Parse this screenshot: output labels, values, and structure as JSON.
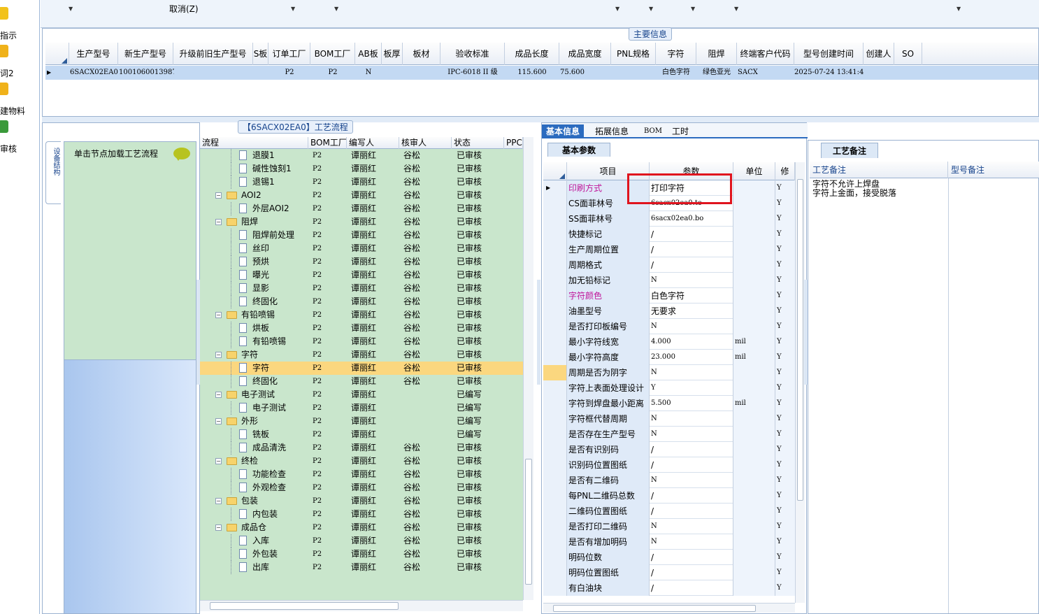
{
  "sidebar": {
    "items": [
      {
        "label": "指示",
        "icon": "lightning-icon"
      },
      {
        "label": "词2",
        "icon": "hand-icon"
      },
      {
        "label": "建物料",
        "icon": "hand-icon"
      },
      {
        "label": "审核",
        "icon": "person-icon"
      }
    ]
  },
  "toolbar": {
    "cancel_label": "取消(Z)"
  },
  "main_info": {
    "title": "主要信息",
    "columns": [
      "生产型号",
      "新生产型号",
      "升级前旧生产型号",
      "S板",
      "订单工厂",
      "BOM工厂",
      "AB板",
      "板厚",
      "板材",
      "验收标准",
      "成品长度",
      "成品宽度",
      "PNL规格",
      "字符",
      "阻焊",
      "终端客户代码",
      "型号创建时间",
      "创建人",
      "SO"
    ],
    "row": [
      "6SACX02EA0",
      "10010600139875",
      "",
      "",
      "P2",
      "P2",
      "N",
      "",
      "",
      "IPC-6018 II 级",
      "115.600",
      "75.600",
      "",
      "白色字符",
      "绿色亚光",
      "SACX",
      "2025-07-24 13:41:41",
      "",
      ""
    ]
  },
  "left_panel": {
    "vertical_tab": "设备结构",
    "load_hint": "单击节点加载工艺流程"
  },
  "process": {
    "title": "【6SACX02EA0】工艺流程",
    "columns": [
      "流程",
      "BOM工厂",
      "编写人",
      "核审人",
      "状态",
      "PPC"
    ],
    "rows": [
      {
        "level": 2,
        "name": "退膜1",
        "bom": "P2",
        "writer": "谭丽红",
        "reviewer": "谷松",
        "status": "已审核"
      },
      {
        "level": 2,
        "name": "碱性蚀刻1",
        "bom": "P2",
        "writer": "谭丽红",
        "reviewer": "谷松",
        "status": "已审核"
      },
      {
        "level": 2,
        "name": "退锡1",
        "bom": "P2",
        "writer": "谭丽红",
        "reviewer": "谷松",
        "status": "已审核"
      },
      {
        "level": 1,
        "name": "AOI2",
        "bom": "P2",
        "writer": "谭丽红",
        "reviewer": "谷松",
        "status": "已审核"
      },
      {
        "level": 2,
        "name": "外层AOI2",
        "bom": "P2",
        "writer": "谭丽红",
        "reviewer": "谷松",
        "status": "已审核"
      },
      {
        "level": 1,
        "name": "阻焊",
        "bom": "P2",
        "writer": "谭丽红",
        "reviewer": "谷松",
        "status": "已审核"
      },
      {
        "level": 2,
        "name": "阻焊前处理",
        "bom": "P2",
        "writer": "谭丽红",
        "reviewer": "谷松",
        "status": "已审核"
      },
      {
        "level": 2,
        "name": "丝印",
        "bom": "P2",
        "writer": "谭丽红",
        "reviewer": "谷松",
        "status": "已审核"
      },
      {
        "level": 2,
        "name": "预烘",
        "bom": "P2",
        "writer": "谭丽红",
        "reviewer": "谷松",
        "status": "已审核"
      },
      {
        "level": 2,
        "name": "曝光",
        "bom": "P2",
        "writer": "谭丽红",
        "reviewer": "谷松",
        "status": "已审核"
      },
      {
        "level": 2,
        "name": "显影",
        "bom": "P2",
        "writer": "谭丽红",
        "reviewer": "谷松",
        "status": "已审核"
      },
      {
        "level": 2,
        "name": "终固化",
        "bom": "P2",
        "writer": "谭丽红",
        "reviewer": "谷松",
        "status": "已审核"
      },
      {
        "level": 1,
        "name": "有铅喷锡",
        "bom": "P2",
        "writer": "谭丽红",
        "reviewer": "谷松",
        "status": "已审核"
      },
      {
        "level": 2,
        "name": "烘板",
        "bom": "P2",
        "writer": "谭丽红",
        "reviewer": "谷松",
        "status": "已审核"
      },
      {
        "level": 2,
        "name": "有铅喷锡",
        "bom": "P2",
        "writer": "谭丽红",
        "reviewer": "谷松",
        "status": "已审核"
      },
      {
        "level": 1,
        "name": "字符",
        "bom": "P2",
        "writer": "谭丽红",
        "reviewer": "谷松",
        "status": "已审核"
      },
      {
        "level": 2,
        "name": "字符",
        "bom": "P2",
        "writer": "谭丽红",
        "reviewer": "谷松",
        "status": "已审核",
        "selected": true
      },
      {
        "level": 2,
        "name": "终固化",
        "bom": "P2",
        "writer": "谭丽红",
        "reviewer": "谷松",
        "status": "已审核"
      },
      {
        "level": 1,
        "name": "电子测试",
        "bom": "P2",
        "writer": "谭丽红",
        "reviewer": "",
        "status": "已编写"
      },
      {
        "level": 2,
        "name": "电子测试",
        "bom": "P2",
        "writer": "谭丽红",
        "reviewer": "",
        "status": "已编写"
      },
      {
        "level": 1,
        "name": "外形",
        "bom": "P2",
        "writer": "谭丽红",
        "reviewer": "",
        "status": "已编写"
      },
      {
        "level": 2,
        "name": "铣板",
        "bom": "P2",
        "writer": "谭丽红",
        "reviewer": "",
        "status": "已编写"
      },
      {
        "level": 2,
        "name": "成品清洗",
        "bom": "P2",
        "writer": "谭丽红",
        "reviewer": "谷松",
        "status": "已审核"
      },
      {
        "level": 1,
        "name": "终检",
        "bom": "P2",
        "writer": "谭丽红",
        "reviewer": "谷松",
        "status": "已审核"
      },
      {
        "level": 2,
        "name": "功能检查",
        "bom": "P2",
        "writer": "谭丽红",
        "reviewer": "谷松",
        "status": "已审核"
      },
      {
        "level": 2,
        "name": "外观检查",
        "bom": "P2",
        "writer": "谭丽红",
        "reviewer": "谷松",
        "status": "已审核"
      },
      {
        "level": 1,
        "name": "包装",
        "bom": "P2",
        "writer": "谭丽红",
        "reviewer": "谷松",
        "status": "已审核"
      },
      {
        "level": 2,
        "name": "内包装",
        "bom": "P2",
        "writer": "谭丽红",
        "reviewer": "谷松",
        "status": "已审核"
      },
      {
        "level": 1,
        "name": "成品仓",
        "bom": "P2",
        "writer": "谭丽红",
        "reviewer": "谷松",
        "status": "已审核"
      },
      {
        "level": 2,
        "name": "入库",
        "bom": "P2",
        "writer": "谭丽红",
        "reviewer": "谷松",
        "status": "已审核"
      },
      {
        "level": 2,
        "name": "外包装",
        "bom": "P2",
        "writer": "谭丽红",
        "reviewer": "谷松",
        "status": "已审核"
      },
      {
        "level": 2,
        "name": "出库",
        "bom": "P2",
        "writer": "谭丽红",
        "reviewer": "谷松",
        "status": "已审核"
      }
    ]
  },
  "detail_tabs": [
    "基本信息",
    "拓展信息",
    "BOM",
    "工时"
  ],
  "basic_params": {
    "title": "基本参数",
    "columns": [
      "项目",
      "参数",
      "单位",
      "修"
    ],
    "rows": [
      {
        "k": "印刷方式",
        "v": "打印字符",
        "u": "",
        "y": "Y",
        "mag": true,
        "cur": true
      },
      {
        "k": "CS面菲林号",
        "v": "6sacx02ea0.to",
        "u": "",
        "y": "Y",
        "f": true
      },
      {
        "k": "SS面菲林号",
        "v": "6sacx02ea0.bo",
        "u": "",
        "y": "Y",
        "f": true
      },
      {
        "k": "快捷标记",
        "v": "/",
        "u": "",
        "y": "Y"
      },
      {
        "k": "生产周期位置",
        "v": "/",
        "u": "",
        "y": "Y"
      },
      {
        "k": "周期格式",
        "v": "/",
        "u": "",
        "y": "Y"
      },
      {
        "k": "加无铅标记",
        "v": "N",
        "u": "",
        "y": "Y",
        "f": true
      },
      {
        "k": "字符颜色",
        "v": "白色字符",
        "u": "",
        "y": "Y",
        "mag": true
      },
      {
        "k": "油墨型号",
        "v": "无要求",
        "u": "",
        "y": "Y"
      },
      {
        "k": "是否打印板编号",
        "v": "N",
        "u": "",
        "y": "Y",
        "f": true
      },
      {
        "k": "最小字符线宽",
        "v": "4.000",
        "u": "mil",
        "y": "Y",
        "f": true
      },
      {
        "k": "最小字符高度",
        "v": "23.000",
        "u": "mil",
        "y": "Y",
        "f": true
      },
      {
        "k": "周期是否为阴字",
        "v": "N",
        "u": "",
        "y": "Y",
        "f": true,
        "hl": true
      },
      {
        "k": "字符上表面处理设计",
        "v": "Y",
        "u": "",
        "y": "Y",
        "f": true
      },
      {
        "k": "字符到焊盘最小距离",
        "v": "5.500",
        "u": "mil",
        "y": "Y",
        "f": true
      },
      {
        "k": "字符框代替周期",
        "v": "N",
        "u": "",
        "y": "Y",
        "f": true
      },
      {
        "k": "是否存在生产型号",
        "v": "N",
        "u": "",
        "y": "Y",
        "f": true
      },
      {
        "k": "是否有识别码",
        "v": "/",
        "u": "",
        "y": "Y"
      },
      {
        "k": "识别码位置图纸",
        "v": "/",
        "u": "",
        "y": "Y"
      },
      {
        "k": "是否有二维码",
        "v": "N",
        "u": "",
        "y": "Y",
        "f": true
      },
      {
        "k": "每PNL二维码总数",
        "v": "/",
        "u": "",
        "y": "Y"
      },
      {
        "k": "二维码位置图纸",
        "v": "/",
        "u": "",
        "y": "Y"
      },
      {
        "k": "是否打印二维码",
        "v": "N",
        "u": "",
        "y": "Y",
        "f": true
      },
      {
        "k": "是否有增加明码",
        "v": "N",
        "u": "",
        "y": "Y",
        "f": true
      },
      {
        "k": "明码位数",
        "v": "/",
        "u": "",
        "y": "Y"
      },
      {
        "k": "明码位置图纸",
        "v": "/",
        "u": "",
        "y": "Y"
      },
      {
        "k": "有白油块",
        "v": "/",
        "u": "",
        "y": "Y"
      }
    ]
  },
  "process_notes": {
    "title": "工艺备注",
    "col1": "工艺备注",
    "col2": "型号备注",
    "lines": [
      "字符不允许上焊盘",
      "字符上金面，接受脱落"
    ]
  }
}
